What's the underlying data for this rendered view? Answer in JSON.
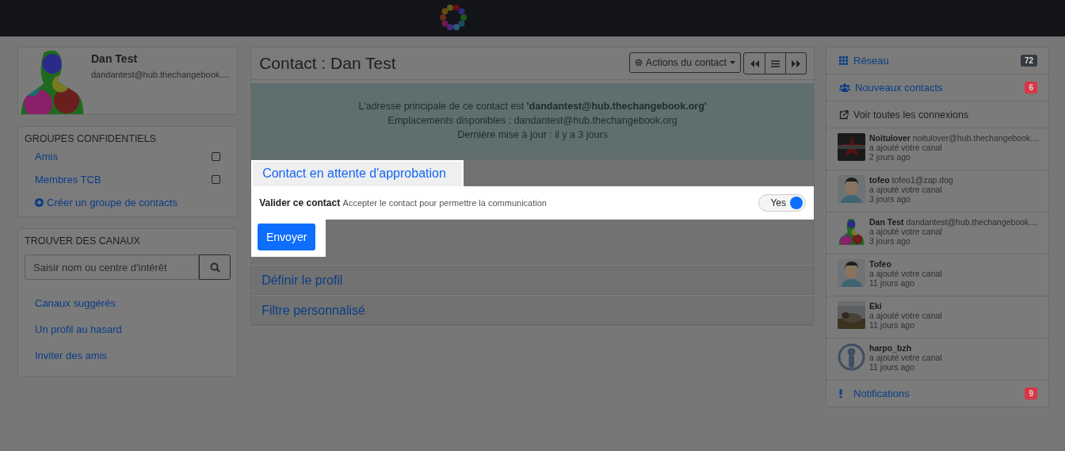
{
  "profile": {
    "name": "Dan Test",
    "address": "dandantest@hub.thechangebook...."
  },
  "groups": {
    "title": "GROUPES CONFIDENTIELS",
    "items": [
      {
        "label": "Amis",
        "checked": false
      },
      {
        "label": "Membres TCB",
        "checked": false
      }
    ],
    "create_link": "Créer un groupe de contacts"
  },
  "find_channels": {
    "title": "TROUVER DES CANAUX",
    "search": {
      "placeholder": "Saisir nom ou centre d'intérêt"
    },
    "links": [
      "Canaux suggérés",
      "Un profil au hasard",
      "Inviter des amis"
    ]
  },
  "contact_panel": {
    "title": "Contact : Dan Test",
    "actions_button": "Actions du contact",
    "info_lines": [
      "L'adresse principale de ce contact est **'dandantest@hub.thechangebook.org'**",
      "Emplacements disponibles : dandantest@hub.thechangebook.org",
      "Dernière mise à jour : il y a 3 jours"
    ],
    "pending_section": {
      "title": "Contact en attente d'approbation",
      "field_label": "Valider ce contact",
      "field_hint": "Accepter le contact pour permettre la communication",
      "toggle": {
        "label": "Yes",
        "on": true
      },
      "submit": "Envoyer"
    },
    "sections": [
      "Définir le profil",
      "Filtre personnalisé"
    ]
  },
  "right_nav": [
    {
      "kind": "grid",
      "label": "Réseau",
      "badge": "72",
      "color": "#343a40"
    },
    {
      "kind": "users",
      "label": "Nouveaux contacts",
      "badge": "6",
      "color": "#dc3545"
    },
    {
      "kind": "external",
      "label": "Voir toutes les connexions"
    }
  ],
  "connections": [
    {
      "name": "Noitulover",
      "address": "noitulover@hub.thechangebook....",
      "action": "a ajouté votre canal",
      "time": "2 jours ago"
    },
    {
      "name": "tofeo",
      "address": "tofeo1@zap.dog",
      "action": "a ajouté votre canal",
      "time": "3 jours ago"
    },
    {
      "name": "Dan Test",
      "address": "dandantest@hub.thechangebook....",
      "action": "a ajouté votre canal",
      "time": "3 jours ago"
    },
    {
      "name": "Tofeo",
      "action": "a ajouté votre canal",
      "time": "11 jours ago"
    },
    {
      "name": "Eki",
      "action": "a ajouté votre canal",
      "time": "11 jours ago"
    },
    {
      "name": "harpo_bzh",
      "action": "a ajouté votre canal",
      "time": "11 jours ago"
    }
  ],
  "notifications": {
    "label": "Notifications",
    "badge": "9",
    "color": "#dc3545"
  }
}
